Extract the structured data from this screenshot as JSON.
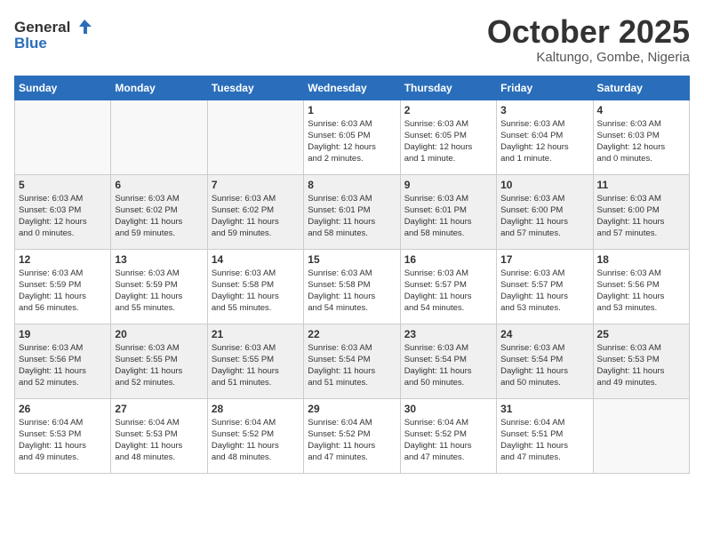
{
  "header": {
    "logo_general": "General",
    "logo_blue": "Blue",
    "title": "October 2025",
    "subtitle": "Kaltungo, Gombe, Nigeria"
  },
  "days_of_week": [
    "Sunday",
    "Monday",
    "Tuesday",
    "Wednesday",
    "Thursday",
    "Friday",
    "Saturday"
  ],
  "weeks": [
    {
      "shade": "white",
      "days": [
        {
          "num": "",
          "info": ""
        },
        {
          "num": "",
          "info": ""
        },
        {
          "num": "",
          "info": ""
        },
        {
          "num": "1",
          "info": "Sunrise: 6:03 AM\nSunset: 6:05 PM\nDaylight: 12 hours\nand 2 minutes."
        },
        {
          "num": "2",
          "info": "Sunrise: 6:03 AM\nSunset: 6:05 PM\nDaylight: 12 hours\nand 1 minute."
        },
        {
          "num": "3",
          "info": "Sunrise: 6:03 AM\nSunset: 6:04 PM\nDaylight: 12 hours\nand 1 minute."
        },
        {
          "num": "4",
          "info": "Sunrise: 6:03 AM\nSunset: 6:03 PM\nDaylight: 12 hours\nand 0 minutes."
        }
      ]
    },
    {
      "shade": "shaded",
      "days": [
        {
          "num": "5",
          "info": "Sunrise: 6:03 AM\nSunset: 6:03 PM\nDaylight: 12 hours\nand 0 minutes."
        },
        {
          "num": "6",
          "info": "Sunrise: 6:03 AM\nSunset: 6:02 PM\nDaylight: 11 hours\nand 59 minutes."
        },
        {
          "num": "7",
          "info": "Sunrise: 6:03 AM\nSunset: 6:02 PM\nDaylight: 11 hours\nand 59 minutes."
        },
        {
          "num": "8",
          "info": "Sunrise: 6:03 AM\nSunset: 6:01 PM\nDaylight: 11 hours\nand 58 minutes."
        },
        {
          "num": "9",
          "info": "Sunrise: 6:03 AM\nSunset: 6:01 PM\nDaylight: 11 hours\nand 58 minutes."
        },
        {
          "num": "10",
          "info": "Sunrise: 6:03 AM\nSunset: 6:00 PM\nDaylight: 11 hours\nand 57 minutes."
        },
        {
          "num": "11",
          "info": "Sunrise: 6:03 AM\nSunset: 6:00 PM\nDaylight: 11 hours\nand 57 minutes."
        }
      ]
    },
    {
      "shade": "white",
      "days": [
        {
          "num": "12",
          "info": "Sunrise: 6:03 AM\nSunset: 5:59 PM\nDaylight: 11 hours\nand 56 minutes."
        },
        {
          "num": "13",
          "info": "Sunrise: 6:03 AM\nSunset: 5:59 PM\nDaylight: 11 hours\nand 55 minutes."
        },
        {
          "num": "14",
          "info": "Sunrise: 6:03 AM\nSunset: 5:58 PM\nDaylight: 11 hours\nand 55 minutes."
        },
        {
          "num": "15",
          "info": "Sunrise: 6:03 AM\nSunset: 5:58 PM\nDaylight: 11 hours\nand 54 minutes."
        },
        {
          "num": "16",
          "info": "Sunrise: 6:03 AM\nSunset: 5:57 PM\nDaylight: 11 hours\nand 54 minutes."
        },
        {
          "num": "17",
          "info": "Sunrise: 6:03 AM\nSunset: 5:57 PM\nDaylight: 11 hours\nand 53 minutes."
        },
        {
          "num": "18",
          "info": "Sunrise: 6:03 AM\nSunset: 5:56 PM\nDaylight: 11 hours\nand 53 minutes."
        }
      ]
    },
    {
      "shade": "shaded",
      "days": [
        {
          "num": "19",
          "info": "Sunrise: 6:03 AM\nSunset: 5:56 PM\nDaylight: 11 hours\nand 52 minutes."
        },
        {
          "num": "20",
          "info": "Sunrise: 6:03 AM\nSunset: 5:55 PM\nDaylight: 11 hours\nand 52 minutes."
        },
        {
          "num": "21",
          "info": "Sunrise: 6:03 AM\nSunset: 5:55 PM\nDaylight: 11 hours\nand 51 minutes."
        },
        {
          "num": "22",
          "info": "Sunrise: 6:03 AM\nSunset: 5:54 PM\nDaylight: 11 hours\nand 51 minutes."
        },
        {
          "num": "23",
          "info": "Sunrise: 6:03 AM\nSunset: 5:54 PM\nDaylight: 11 hours\nand 50 minutes."
        },
        {
          "num": "24",
          "info": "Sunrise: 6:03 AM\nSunset: 5:54 PM\nDaylight: 11 hours\nand 50 minutes."
        },
        {
          "num": "25",
          "info": "Sunrise: 6:03 AM\nSunset: 5:53 PM\nDaylight: 11 hours\nand 49 minutes."
        }
      ]
    },
    {
      "shade": "white",
      "days": [
        {
          "num": "26",
          "info": "Sunrise: 6:04 AM\nSunset: 5:53 PM\nDaylight: 11 hours\nand 49 minutes."
        },
        {
          "num": "27",
          "info": "Sunrise: 6:04 AM\nSunset: 5:53 PM\nDaylight: 11 hours\nand 48 minutes."
        },
        {
          "num": "28",
          "info": "Sunrise: 6:04 AM\nSunset: 5:52 PM\nDaylight: 11 hours\nand 48 minutes."
        },
        {
          "num": "29",
          "info": "Sunrise: 6:04 AM\nSunset: 5:52 PM\nDaylight: 11 hours\nand 47 minutes."
        },
        {
          "num": "30",
          "info": "Sunrise: 6:04 AM\nSunset: 5:52 PM\nDaylight: 11 hours\nand 47 minutes."
        },
        {
          "num": "31",
          "info": "Sunrise: 6:04 AM\nSunset: 5:51 PM\nDaylight: 11 hours\nand 47 minutes."
        },
        {
          "num": "",
          "info": ""
        }
      ]
    }
  ]
}
